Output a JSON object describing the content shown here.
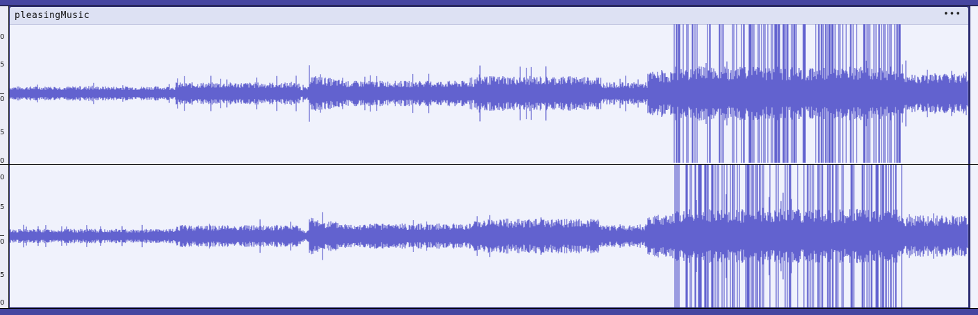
{
  "track": {
    "clip_name": "pleasingMusic",
    "menu_label": "•••",
    "channel_count": 2,
    "ruler_labels": [
      "0",
      "5",
      "0",
      "5",
      "0",
      "0",
      "5",
      "0",
      "5",
      "0"
    ]
  },
  "colors": {
    "waveform": "#6262cf",
    "clip_background": "#f0f2fc",
    "header_background": "#dde1f3",
    "frame": "#3a3a8c"
  }
}
